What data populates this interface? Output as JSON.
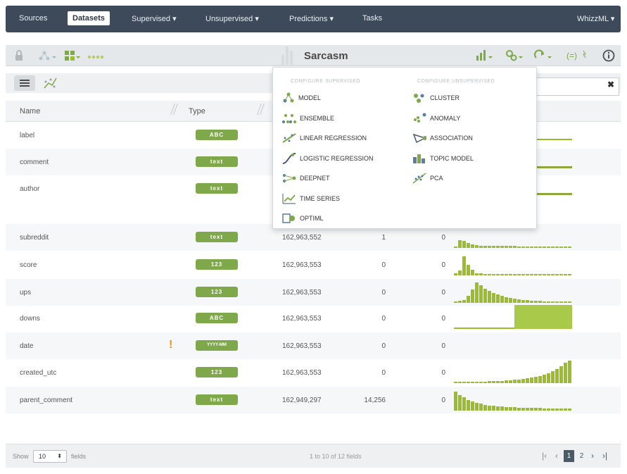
{
  "nav": {
    "items": [
      "Sources",
      "Datasets",
      "Supervised ▾",
      "Unsupervised ▾",
      "Predictions ▾",
      "Tasks"
    ],
    "user_menu": "WhizzML ▾"
  },
  "dataset": {
    "title": "Sarcasm"
  },
  "table": {
    "headers": {
      "name": "Name",
      "type": "Type"
    },
    "rows": [
      {
        "name": "label",
        "type": "ABC",
        "count": "",
        "missing": "",
        "errors": "",
        "hist": "const"
      },
      {
        "name": "comment",
        "type": "text",
        "count": "",
        "missing": "",
        "errors": "",
        "hist": "text"
      },
      {
        "name": "author",
        "type": "text",
        "count": "",
        "missing": "",
        "errors": "",
        "hist": "text"
      },
      {
        "name": "subreddit",
        "type": "text",
        "count": "162,963,552",
        "missing": "1",
        "errors": "0",
        "hist": "decay"
      },
      {
        "name": "score",
        "type": "123",
        "count": "162,963,553",
        "missing": "0",
        "errors": "0",
        "hist": "spike"
      },
      {
        "name": "ups",
        "type": "123",
        "count": "162,963,553",
        "missing": "0",
        "errors": "0",
        "hist": "hump"
      },
      {
        "name": "downs",
        "type": "ABC",
        "count": "162,963,553",
        "missing": "0",
        "errors": "0",
        "hist": "block"
      },
      {
        "name": "date",
        "type": "YYYY-MM",
        "count": "162,963,553",
        "missing": "0",
        "errors": "0",
        "hist": "none",
        "warning": "!"
      },
      {
        "name": "created_utc",
        "type": "123",
        "count": "162,963,553",
        "missing": "0",
        "errors": "0",
        "hist": "grow"
      },
      {
        "name": "parent_comment",
        "type": "text",
        "count": "162,949,297",
        "missing": "14,256",
        "errors": "0",
        "hist": "falloff"
      }
    ]
  },
  "footer": {
    "show_label": "Show",
    "page_size": "10",
    "fields_label": "fields",
    "range": "1 to 10 of 12 fields",
    "pages": [
      "1",
      "2"
    ]
  },
  "dropdown": {
    "supervised_header": "CONFIGURE SUPERVISED",
    "unsupervised_header": "CONFIGURE UNSUPERVISED",
    "supervised": [
      {
        "label": "MODEL",
        "icon": "model-icon"
      },
      {
        "label": "ENSEMBLE",
        "icon": "ensemble-icon"
      },
      {
        "label": "LINEAR REGRESSION",
        "icon": "linear-regression-icon"
      },
      {
        "label": "LOGISTIC REGRESSION",
        "icon": "logistic-regression-icon"
      },
      {
        "label": "DEEPNET",
        "icon": "deepnet-icon"
      },
      {
        "label": "TIME SERIES",
        "icon": "time-series-icon"
      },
      {
        "label": "OPTIML",
        "icon": "optiml-icon"
      }
    ],
    "unsupervised": [
      {
        "label": "CLUSTER",
        "icon": "cluster-icon"
      },
      {
        "label": "ANOMALY",
        "icon": "anomaly-icon"
      },
      {
        "label": "ASSOCIATION",
        "icon": "association-icon"
      },
      {
        "label": "TOPIC MODEL",
        "icon": "topic-model-icon"
      },
      {
        "label": "PCA",
        "icon": "pca-icon"
      }
    ]
  },
  "colors": {
    "nav_bg": "#3c4a5a",
    "accent_green": "#9cbe25",
    "badge_green": "#7fa84a",
    "warning": "#e8920c"
  }
}
